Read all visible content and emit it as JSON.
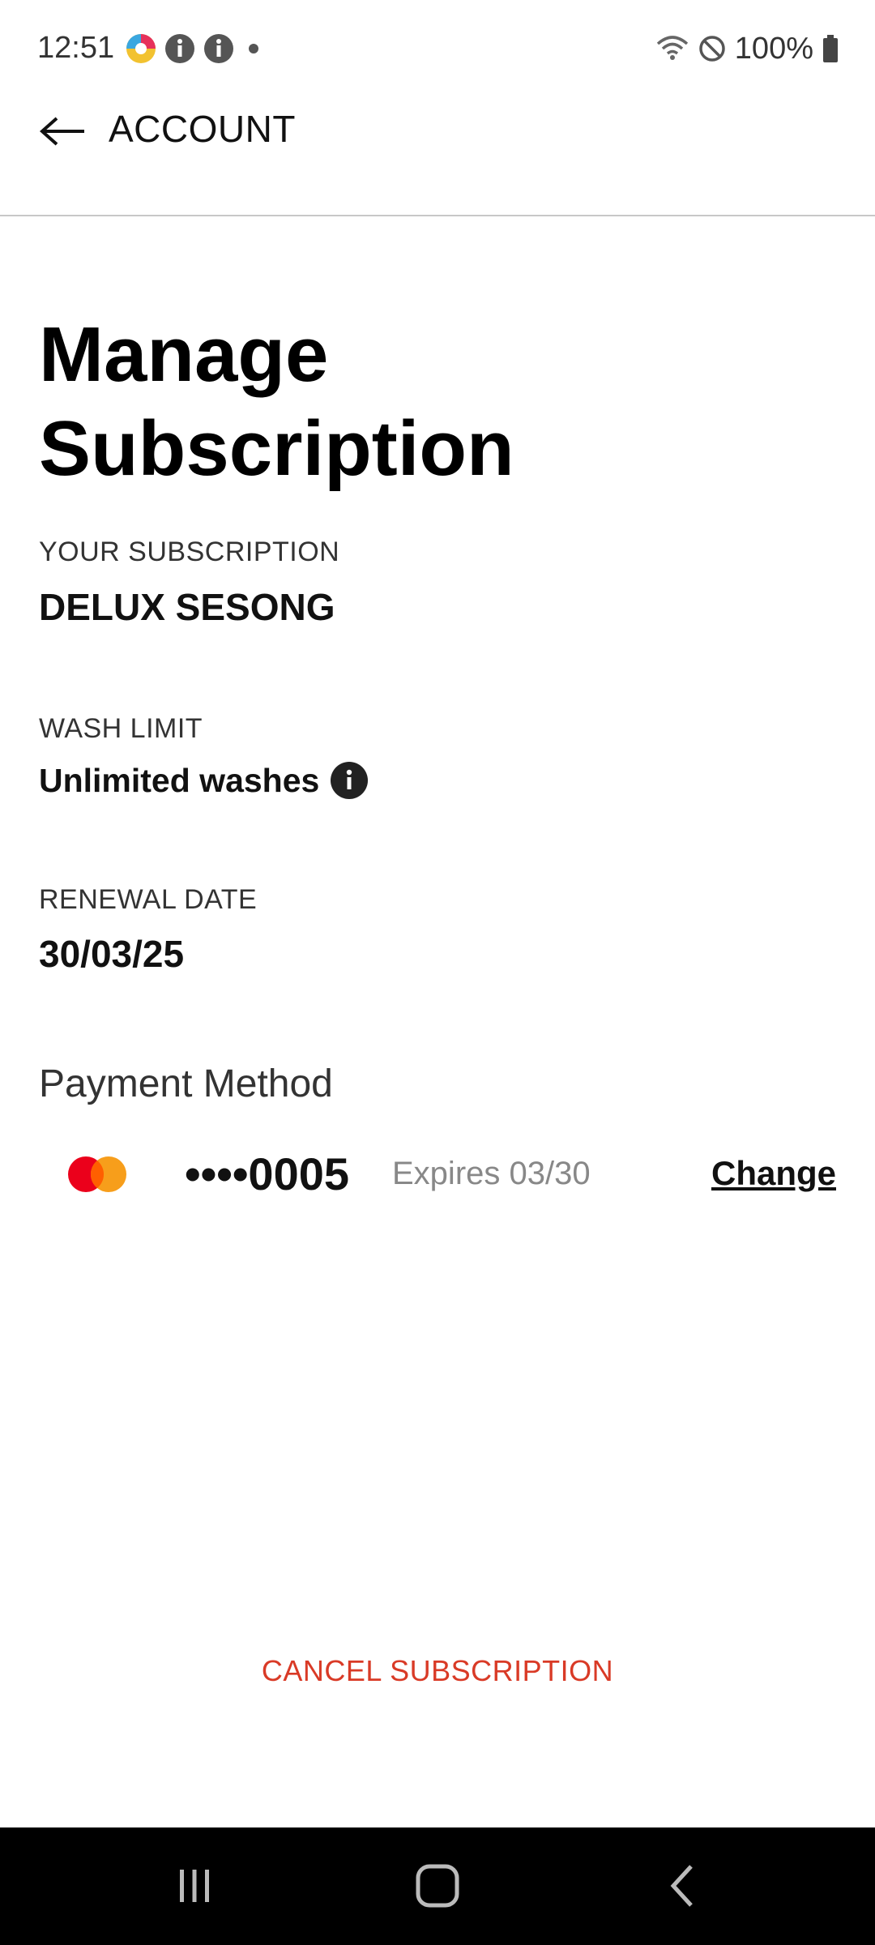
{
  "status_bar": {
    "time": "12:51",
    "battery": "100%"
  },
  "app_bar": {
    "title": "ACCOUNT"
  },
  "page": {
    "title_line1": "Manage",
    "title_line2": "Subscription"
  },
  "subscription": {
    "label": "YOUR SUBSCRIPTION",
    "value": "DELUX SESONG"
  },
  "wash_limit": {
    "label": "WASH LIMIT",
    "value": "Unlimited washes"
  },
  "renewal": {
    "label": "RENEWAL DATE",
    "value": "30/03/25"
  },
  "payment": {
    "heading": "Payment Method",
    "card_number": "••••0005",
    "expires": "Expires 03/30",
    "change_label": "Change",
    "card_brand_icon": "mastercard-icon"
  },
  "actions": {
    "cancel_label": "CANCEL SUBSCRIPTION"
  },
  "colors": {
    "accent_red": "#d93a26",
    "nav_bar": "#000000"
  }
}
